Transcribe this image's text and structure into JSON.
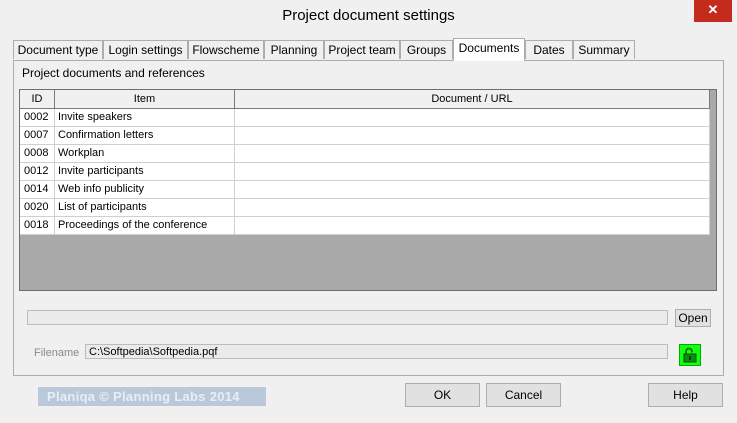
{
  "window": {
    "title": "Project document settings",
    "close_glyph": "✕"
  },
  "tabs": [
    {
      "label": "Document type"
    },
    {
      "label": "Login settings"
    },
    {
      "label": "Flowscheme"
    },
    {
      "label": "Planning"
    },
    {
      "label": "Project team"
    },
    {
      "label": "Groups"
    },
    {
      "label": "Documents",
      "active": true
    },
    {
      "label": "Dates"
    },
    {
      "label": "Summary"
    }
  ],
  "panel": {
    "section_label": "Project documents and references",
    "table": {
      "headers": [
        "ID",
        "Item",
        "Document / URL"
      ],
      "rows": [
        {
          "id": "0002",
          "item": "Invite speakers",
          "doc": ""
        },
        {
          "id": "0007",
          "item": "Confirmation letters",
          "doc": ""
        },
        {
          "id": "0008",
          "item": "Workplan",
          "doc": ""
        },
        {
          "id": "0012",
          "item": "Invite participants",
          "doc": ""
        },
        {
          "id": "0014",
          "item": "Web info publicity",
          "doc": ""
        },
        {
          "id": "0020",
          "item": "List of participants",
          "doc": ""
        },
        {
          "id": "0018",
          "item": "Proceedings of the conference",
          "doc": ""
        }
      ]
    },
    "open_button": "Open",
    "filename_label": "Filename",
    "filename_value": "C:\\Softpedia\\Softpedia.pqf",
    "lock_icon": "unlocked-padlock-icon",
    "lock_color": "#12ff12"
  },
  "footer": {
    "brand_text": "Planiqa    © Planning Labs 2014",
    "ok_label": "OK",
    "cancel_label": "Cancel",
    "help_label": "Help"
  }
}
